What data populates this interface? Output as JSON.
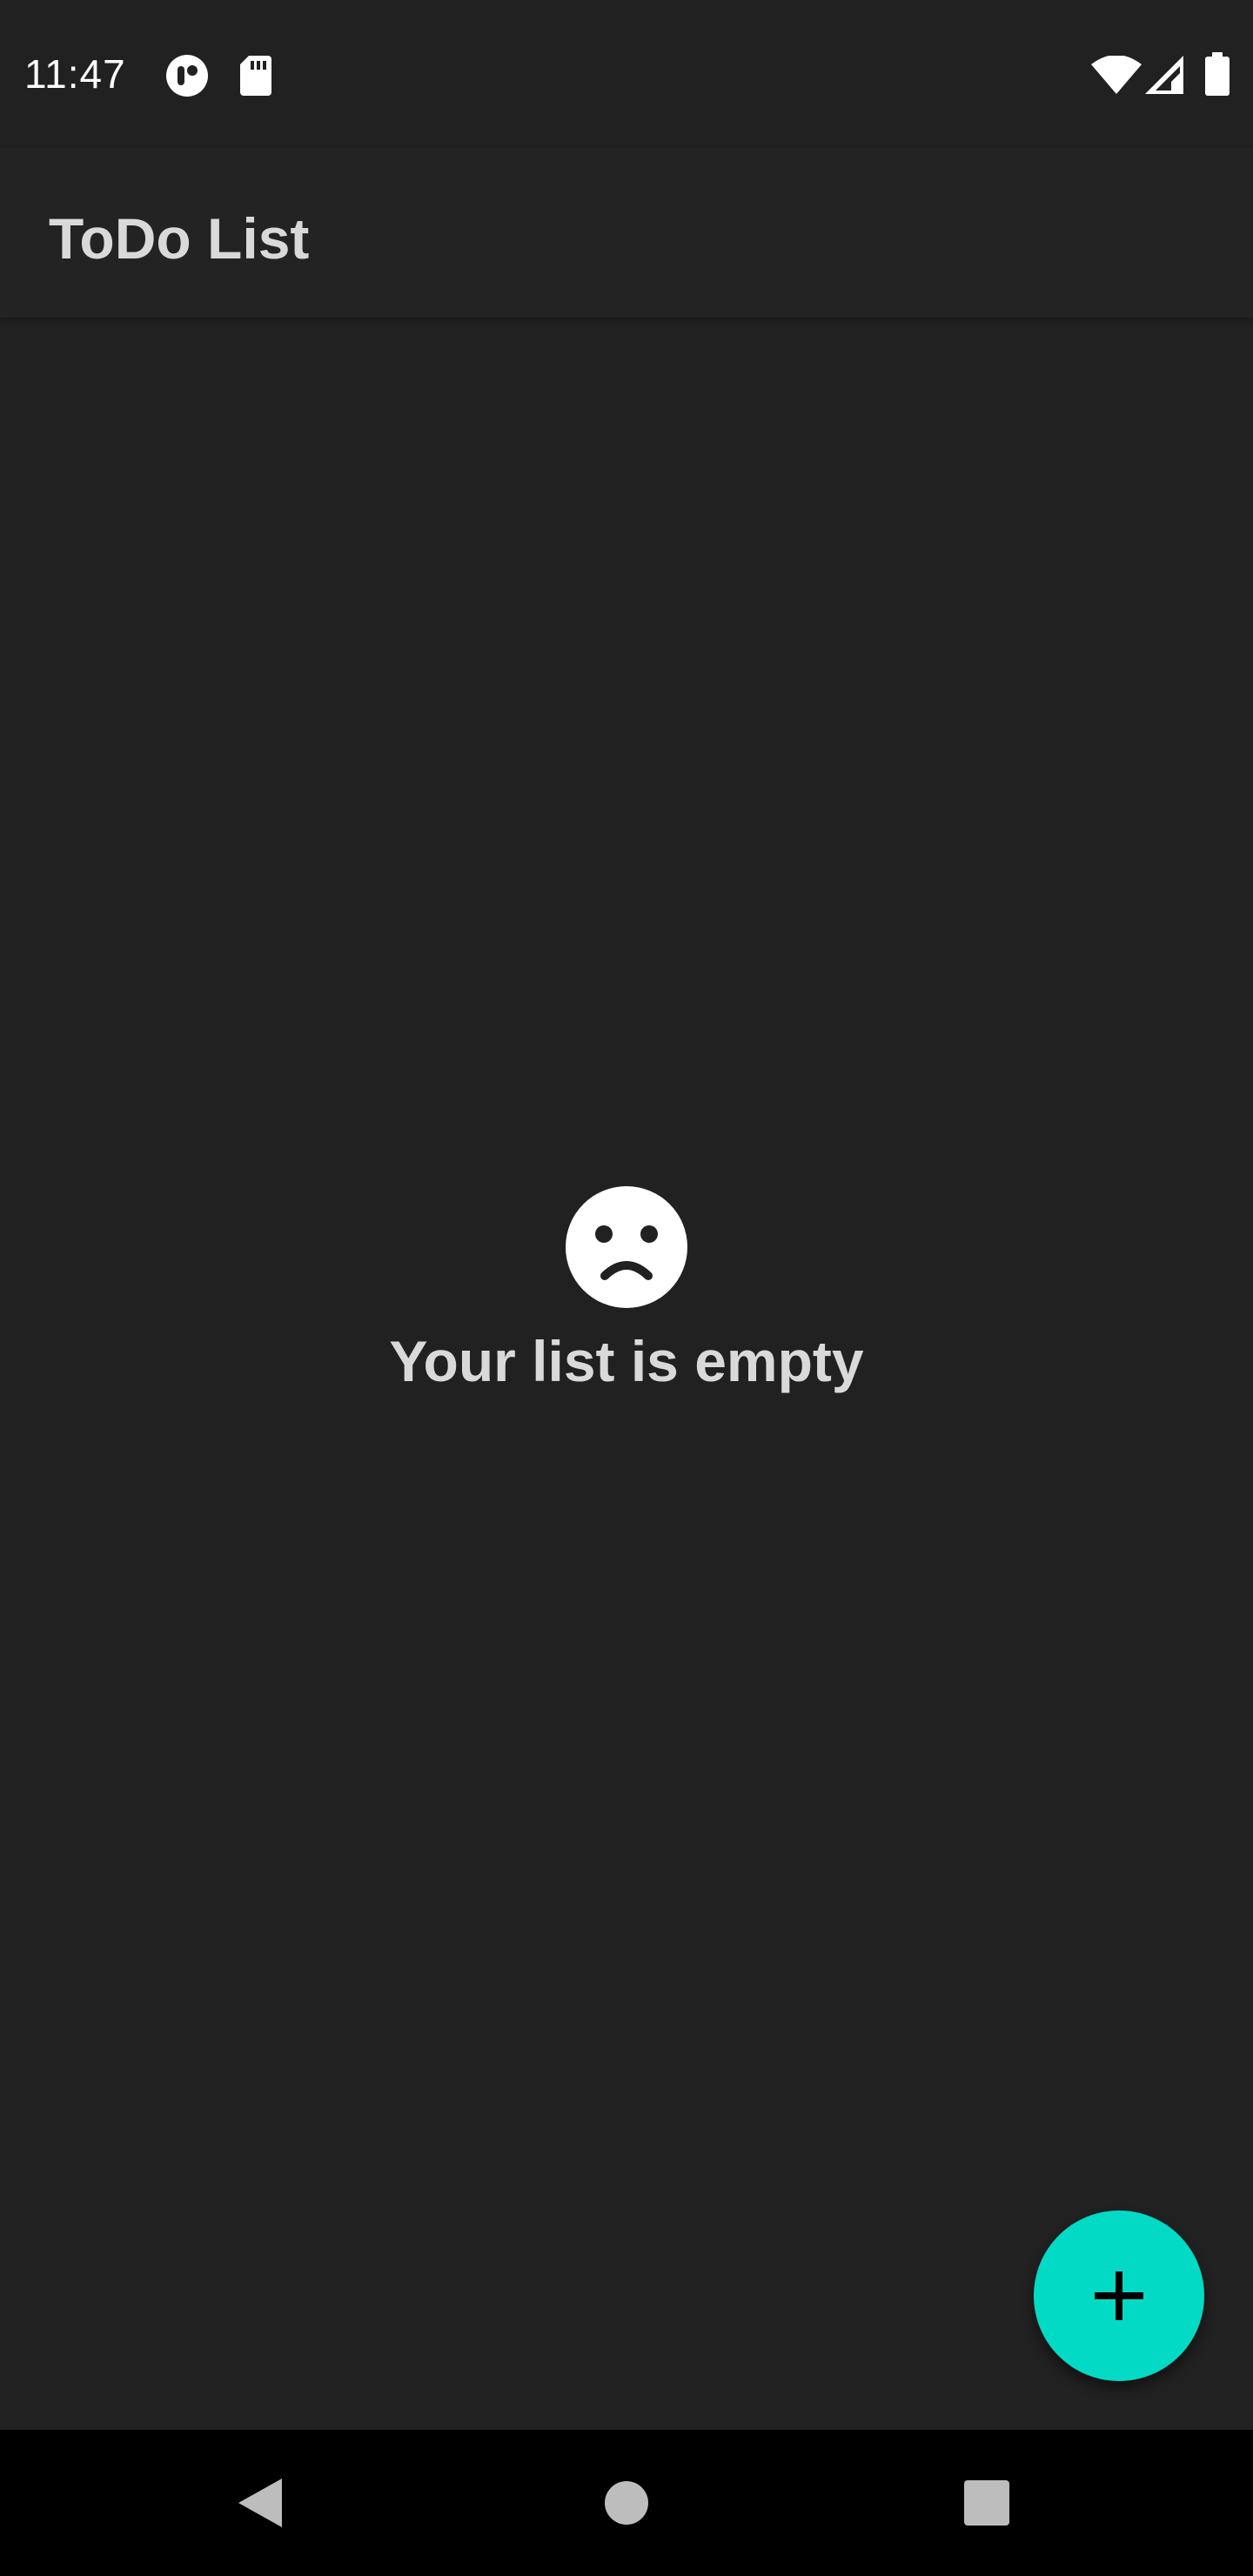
{
  "status_bar": {
    "time": "11:47",
    "icons": [
      "assistant-status-icon",
      "sd-card-icon",
      "wifi-icon",
      "cell-signal-icon",
      "battery-icon"
    ]
  },
  "app_bar": {
    "title": "ToDo List"
  },
  "empty_state": {
    "icon": "sad-face-icon",
    "message": "Your list is empty"
  },
  "fab": {
    "icon": "plus-icon",
    "color": "#03dac5"
  },
  "nav_bar": {
    "buttons": [
      "back-icon",
      "home-icon",
      "recents-icon"
    ]
  },
  "colors": {
    "background": "#212121",
    "app_bar": "#232323",
    "text_primary": "#d9d9d9",
    "accent": "#03dac5"
  }
}
